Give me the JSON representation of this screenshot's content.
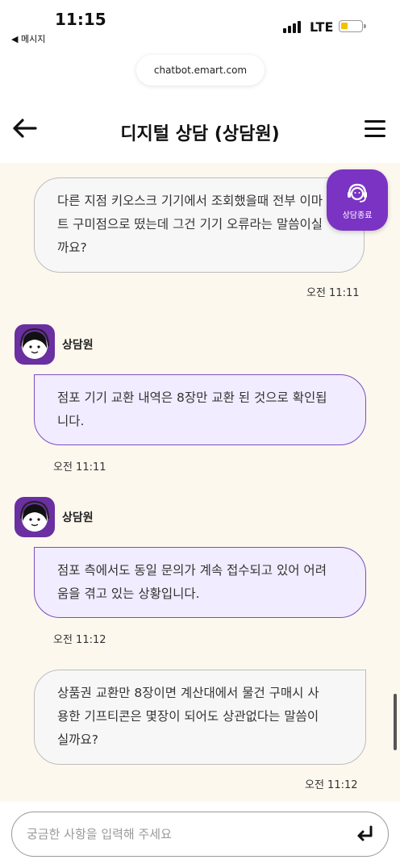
{
  "status": {
    "time": "11:15",
    "back_app": "◀ 메시지",
    "network": "LTE"
  },
  "browser": {
    "url": "chatbot.emart.com"
  },
  "header": {
    "title": "디지털 상담 (상담원)"
  },
  "end_button": {
    "label": "상담종료"
  },
  "messages": [
    {
      "sender": "user",
      "lines": [
        "다른 지점 키오스크 기기에서 조회했을때 전부 이마",
        "트 구미점으로 떴는데 그건 기기 오류라는 말씀이실",
        "까요?"
      ],
      "time": "오전 11:11"
    },
    {
      "sender": "agent",
      "name": "상담원",
      "lines": [
        "점포 기기 교환 내역은 8장만 교환 된 것으로 확인됩",
        "니다."
      ],
      "time": "오전 11:11"
    },
    {
      "sender": "agent",
      "name": "상담원",
      "lines": [
        "점포 측에서도 동일 문의가 계속 접수되고 있어 어려",
        "움을 겪고 있는 상황입니다."
      ],
      "time": "오전 11:12"
    },
    {
      "sender": "user",
      "lines": [
        "상품권 교환만 8장이면 계산대에서 물건 구매시 사",
        "용한 기프티콘은 몇장이 되어도 상관없다는 말씀이",
        "실까요?"
      ],
      "time": "오전 11:12"
    }
  ],
  "input": {
    "placeholder": "궁금한 사항을 입력해 주세요",
    "value": ""
  },
  "colors": {
    "accent": "#7b33c4",
    "chat_background": "#fdf8ee",
    "agent_bubble": "#f1ecff",
    "agent_border": "#7a4fbf",
    "user_bubble": "#f7f7f7"
  }
}
